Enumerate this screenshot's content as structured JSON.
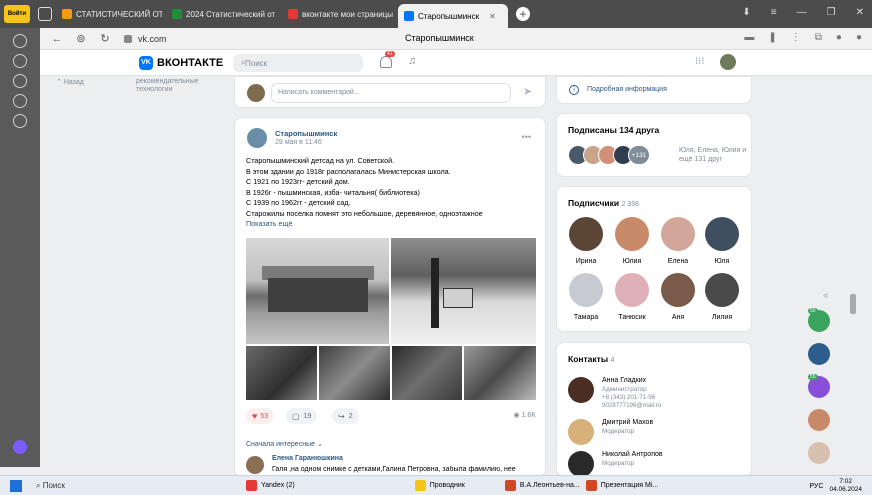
{
  "browser": {
    "tabs": [
      {
        "label": "СТАТИСТИЧЕСКИЙ ОТЧ",
        "color": "#f39c12"
      },
      {
        "label": "2024 Статистический от",
        "color": "#1e8e3e"
      },
      {
        "label": "вконтакте мои страницы",
        "color": "#e53935"
      },
      {
        "label": "Старопышминск",
        "color": "#0077ff"
      }
    ],
    "yandex_btn": "Войти",
    "url": "vk.com",
    "page_title": "Старопышминск"
  },
  "vk": {
    "logo": "ВКОНТАКТЕ",
    "logo_mark": "VK",
    "search_placeholder": "Поиск",
    "notif_count": "41"
  },
  "leftnav": {
    "back": "Назад",
    "rec": "рекомендательные технологии"
  },
  "comment_box": {
    "placeholder": "Написать комментарий..."
  },
  "post": {
    "group": "Старопышминск",
    "date": "29 мая в 11:46",
    "lines": [
      "Старопышминский детсад на ул. Советской.",
      "В этом здании до 1918г располагалась Министерская школа.",
      "С 1921 по 1923гг- детский дом.",
      "В 1926г - пышминская, изба- читальня( библиотека)",
      "С 1939 по 1962гг - детский сад.",
      "Старожилы поселка помнят это небольшое, деревянное, одноэтажное"
    ],
    "show_more": "Показать ещё",
    "likes": "53",
    "comments": "19",
    "shares": "2",
    "views": "1.6K",
    "sort": "Сначала интересные",
    "comment": {
      "author": "Елена Гаранюшкина",
      "text": "Галя ,на одном снимке с детками,Галина Петровна, забыла фамилию, нее"
    }
  },
  "right": {
    "info": "Подробная информация",
    "friends_title": "Подписаны 134 друга",
    "friends_more": "+131",
    "friends_names": "Юля, Елена, Юлия и ещё 131 друг",
    "subs_title": "Подписчики",
    "subs_count": "2 398",
    "subs": [
      {
        "name": "Ирина",
        "color": "#5b4636"
      },
      {
        "name": "Юлия",
        "color": "#c98a6a"
      },
      {
        "name": "Елена",
        "color": "#d2a79a"
      },
      {
        "name": "Юля",
        "color": "#3f4f5f"
      },
      {
        "name": "Тамара",
        "color": "#c7cbd1"
      },
      {
        "name": "Танюсик",
        "color": "#e0b0b8"
      },
      {
        "name": "Аня",
        "color": "#7a5a48"
      },
      {
        "name": "Лилия",
        "color": "#4a4a4a"
      }
    ],
    "contacts_title": "Контакты",
    "contacts_count": "4",
    "contacts": [
      {
        "name": "Анна Гладких",
        "role": "Администратор",
        "extra1": "+8 (343) 201-71-96",
        "extra2": "9028777196@mail.ru",
        "color": "#4b2e23"
      },
      {
        "name": "Дмитрий Махов",
        "role": "Модератор",
        "extra1": "",
        "extra2": "",
        "color": "#d7b07a"
      },
      {
        "name": "Николай Антропов",
        "role": "Модератор",
        "extra1": "",
        "extra2": "",
        "color": "#2a2a2a"
      }
    ],
    "bubble_counts": [
      "50",
      "55"
    ]
  },
  "taskbar": {
    "search": "Поиск",
    "apps": [
      {
        "label": "Yandex (2)",
        "color": "#e53935"
      },
      {
        "label": "Проводник",
        "color": "#f5c518"
      },
      {
        "label": "В.А.Леонтьев-на...",
        "color": "#d24726"
      },
      {
        "label": "Презентация Mi...",
        "color": "#d24726"
      }
    ],
    "lang": "РУС",
    "time": "7:02",
    "date": "04.06.2024"
  }
}
